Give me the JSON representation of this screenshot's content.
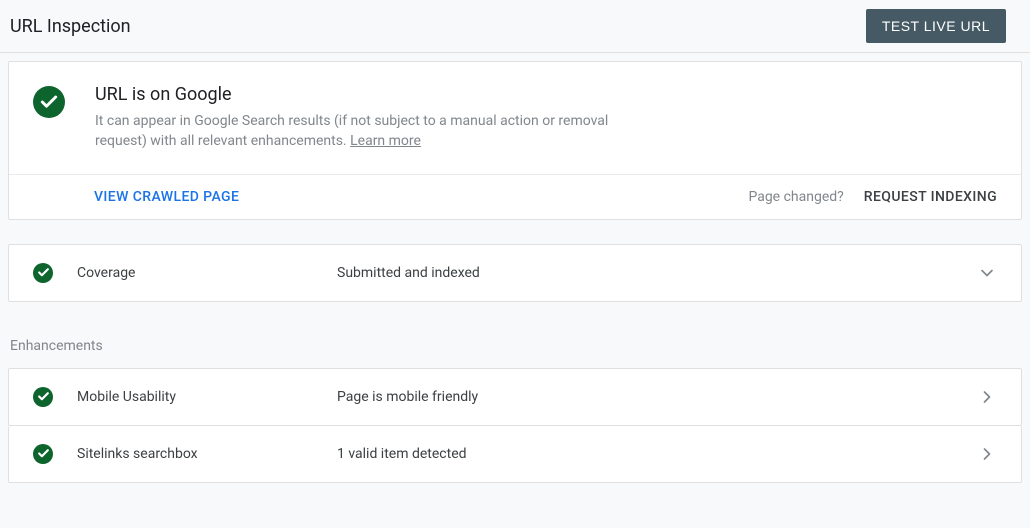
{
  "header": {
    "title": "URL Inspection",
    "test_live_label": "TEST LIVE URL"
  },
  "main": {
    "heading": "URL is on Google",
    "description_pre": "It can appear in Google Search results (if not subject to a manual action or removal request) with all relevant enhancements. ",
    "learn_more": "Learn more",
    "view_crawled": "VIEW CRAWLED PAGE",
    "page_changed": "Page changed?",
    "request_indexing": "REQUEST INDEXING"
  },
  "coverage": {
    "label": "Coverage",
    "value": "Submitted and indexed"
  },
  "enhancements": {
    "section_label": "Enhancements",
    "items": [
      {
        "label": "Mobile Usability",
        "value": "Page is mobile friendly"
      },
      {
        "label": "Sitelinks searchbox",
        "value": "1 valid item detected"
      }
    ]
  }
}
